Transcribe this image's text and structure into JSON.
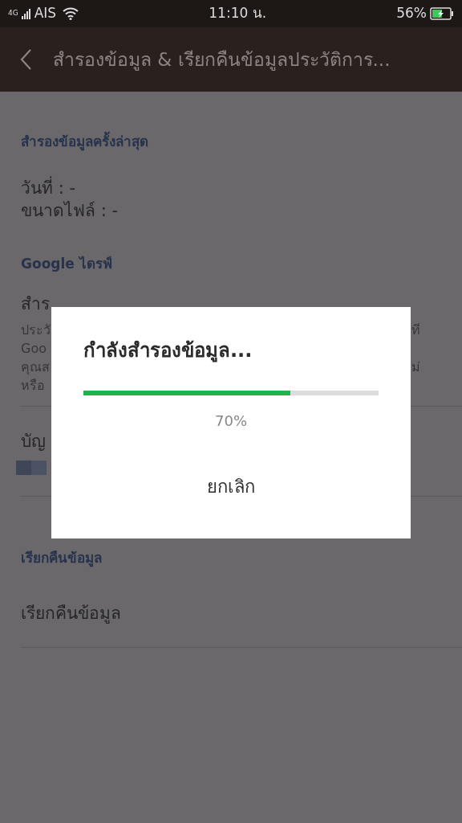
{
  "status_bar": {
    "network": "4G",
    "carrier": "AIS",
    "time": "11:10 น.",
    "battery": "56%",
    "charging": true
  },
  "app_bar": {
    "title": "สำรองข้อมูล & เรียกคืนข้อมูลประวัติการ..."
  },
  "sections": [
    {
      "header": "สำรองข้อมูลครั้งล่าสุด",
      "items": [
        {
          "kind": "info",
          "lines": [
            "วันที่ : -",
            "ขนาดไฟล์ : -"
          ]
        }
      ]
    },
    {
      "header": "Google ไดรฟ์",
      "items": [
        {
          "kind": "setting",
          "title": "สำร",
          "description": [
            {
              "left": "ประวั",
              "right": "ที"
            },
            {
              "left": "Goo"
            },
            {
              "left": "คุณส",
              "right": "ม่"
            },
            {
              "left": "หรือ"
            }
          ]
        },
        {
          "kind": "account",
          "title": "บัญ",
          "redacted": true
        }
      ]
    },
    {
      "header": "เรียกคืนข้อมูล",
      "items": [
        {
          "kind": "action",
          "title": "เรียกคืนข้อมูล"
        }
      ]
    }
  ],
  "dialog": {
    "title": "กำลังสำรองข้อมูล...",
    "progress": {
      "level": 0.7,
      "reading": "70%"
    },
    "buttons": [
      "ยกเลิก"
    ]
  }
}
